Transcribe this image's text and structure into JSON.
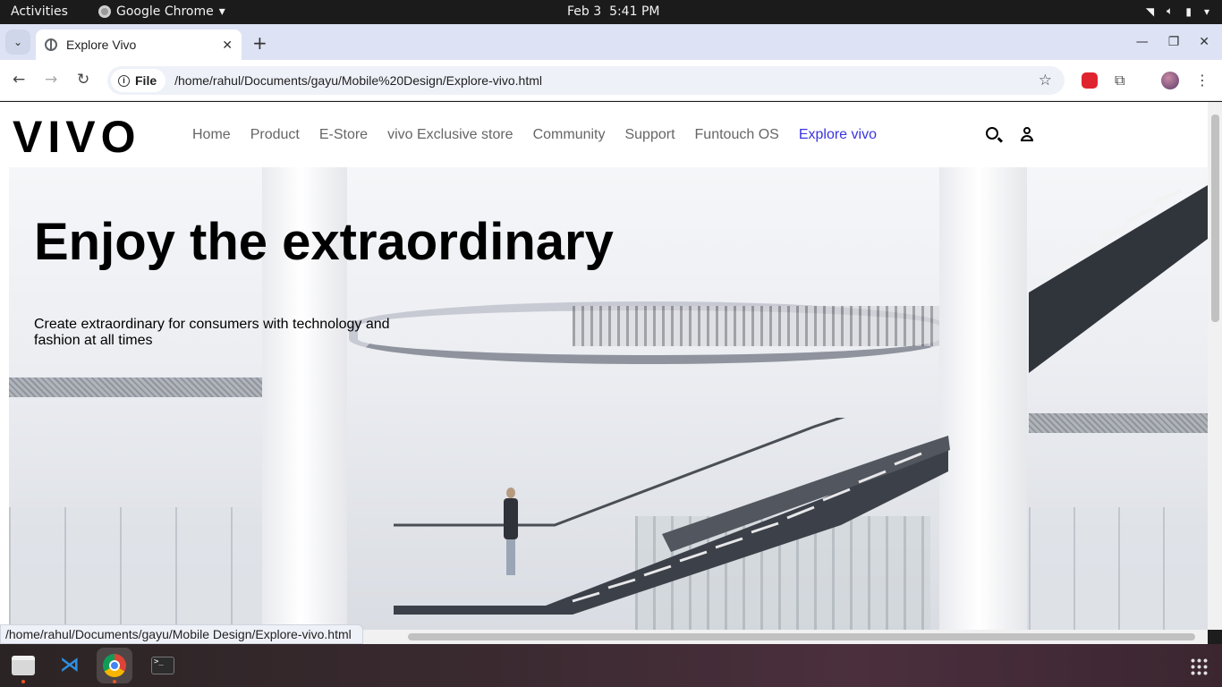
{
  "system": {
    "activities": "Activities",
    "app_name": "Google Chrome",
    "date": "Feb 3",
    "time": "5:41 PM"
  },
  "browser": {
    "tab_title": "Explore Vivo",
    "omnibox_chip": "File",
    "url": "/home/rahul/Documents/gayu/Mobile%20Design/Explore-vivo.html",
    "status_url": "/home/rahul/Documents/gayu/Mobile Design/Explore-vivo.html"
  },
  "site": {
    "logo": "VIVO",
    "nav": [
      "Home",
      "Product",
      "E-Store",
      "vivo Exclusive store",
      "Community",
      "Support",
      "Funtouch OS",
      "Explore vivo"
    ],
    "active_nav": "Explore vivo",
    "accent_color": "#3a34e0"
  },
  "hero": {
    "title": "Enjoy the extraordinary",
    "subtitle": "Create extraordinary for consumers with technology and fashion at all times"
  },
  "icons": {
    "search": "search-icon",
    "account": "user-icon"
  }
}
